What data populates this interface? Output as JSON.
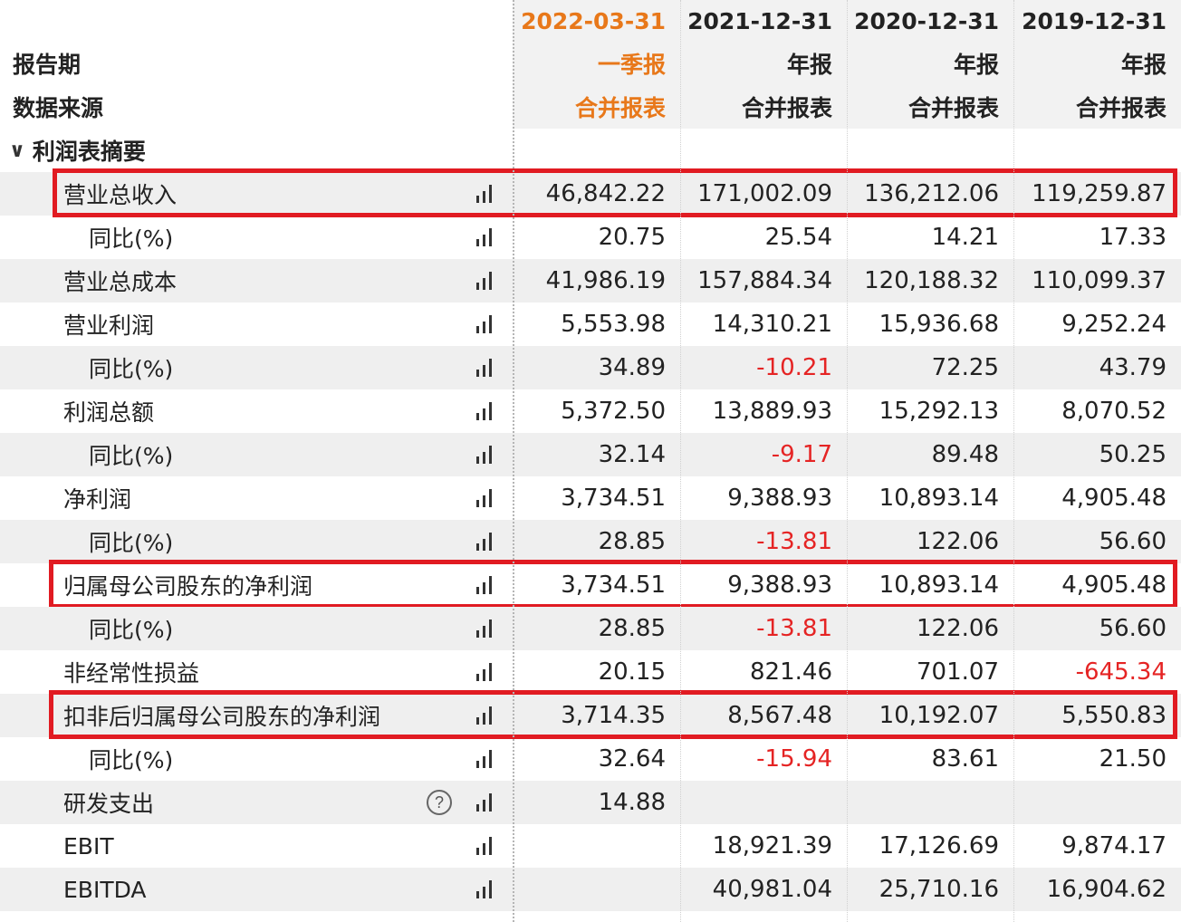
{
  "header": {
    "period_label": "报告期",
    "source_label": "数据来源",
    "columns": [
      {
        "date": "2022-03-31",
        "period": "一季报",
        "source": "合并报表",
        "highlight": true
      },
      {
        "date": "2021-12-31",
        "period": "年报",
        "source": "合并报表",
        "highlight": false
      },
      {
        "date": "2020-12-31",
        "period": "年报",
        "source": "合并报表",
        "highlight": false
      },
      {
        "date": "2019-12-31",
        "period": "年报",
        "source": "合并报表",
        "highlight": false
      }
    ]
  },
  "section": {
    "title": "利润表摘要",
    "icon": "chevron-down-icon"
  },
  "rows": [
    {
      "label": "营业总收入",
      "indent": 1,
      "values": [
        "46,842.22",
        "171,002.09",
        "136,212.06",
        "119,259.87"
      ],
      "negative": [
        false,
        false,
        false,
        false
      ],
      "highlighted": true
    },
    {
      "label": "同比(%)",
      "indent": 2,
      "values": [
        "20.75",
        "25.54",
        "14.21",
        "17.33"
      ],
      "negative": [
        false,
        false,
        false,
        false
      ]
    },
    {
      "label": "营业总成本",
      "indent": 1,
      "values": [
        "41,986.19",
        "157,884.34",
        "120,188.32",
        "110,099.37"
      ],
      "negative": [
        false,
        false,
        false,
        false
      ]
    },
    {
      "label": "营业利润",
      "indent": 1,
      "values": [
        "5,553.98",
        "14,310.21",
        "15,936.68",
        "9,252.24"
      ],
      "negative": [
        false,
        false,
        false,
        false
      ]
    },
    {
      "label": "同比(%)",
      "indent": 2,
      "values": [
        "34.89",
        "-10.21",
        "72.25",
        "43.79"
      ],
      "negative": [
        false,
        true,
        false,
        false
      ]
    },
    {
      "label": "利润总额",
      "indent": 1,
      "values": [
        "5,372.50",
        "13,889.93",
        "15,292.13",
        "8,070.52"
      ],
      "negative": [
        false,
        false,
        false,
        false
      ]
    },
    {
      "label": "同比(%)",
      "indent": 2,
      "values": [
        "32.14",
        "-9.17",
        "89.48",
        "50.25"
      ],
      "negative": [
        false,
        true,
        false,
        false
      ]
    },
    {
      "label": "净利润",
      "indent": 1,
      "values": [
        "3,734.51",
        "9,388.93",
        "10,893.14",
        "4,905.48"
      ],
      "negative": [
        false,
        false,
        false,
        false
      ]
    },
    {
      "label": "同比(%)",
      "indent": 2,
      "values": [
        "28.85",
        "-13.81",
        "122.06",
        "56.60"
      ],
      "negative": [
        false,
        true,
        false,
        false
      ]
    },
    {
      "label": "归属母公司股东的净利润",
      "indent": 1,
      "values": [
        "3,734.51",
        "9,388.93",
        "10,893.14",
        "4,905.48"
      ],
      "negative": [
        false,
        false,
        false,
        false
      ],
      "highlighted": true
    },
    {
      "label": "同比(%)",
      "indent": 2,
      "values": [
        "28.85",
        "-13.81",
        "122.06",
        "56.60"
      ],
      "negative": [
        false,
        true,
        false,
        false
      ]
    },
    {
      "label": "非经常性损益",
      "indent": 1,
      "values": [
        "20.15",
        "821.46",
        "701.07",
        "-645.34"
      ],
      "negative": [
        false,
        false,
        false,
        true
      ]
    },
    {
      "label": "扣非后归属母公司股东的净利润",
      "indent": 1,
      "values": [
        "3,714.35",
        "8,567.48",
        "10,192.07",
        "5,550.83"
      ],
      "negative": [
        false,
        false,
        false,
        false
      ],
      "highlighted": true
    },
    {
      "label": "同比(%)",
      "indent": 2,
      "values": [
        "32.64",
        "-15.94",
        "83.61",
        "21.50"
      ],
      "negative": [
        false,
        true,
        false,
        false
      ]
    },
    {
      "label": "研发支出",
      "indent": 1,
      "values": [
        "14.88",
        "",
        "",
        ""
      ],
      "negative": [
        false,
        false,
        false,
        false
      ],
      "help_icon": "question-circle-icon"
    },
    {
      "label": "EBIT",
      "indent": 1,
      "values": [
        "",
        "18,921.39",
        "17,126.69",
        "9,874.17"
      ],
      "negative": [
        false,
        false,
        false,
        false
      ]
    },
    {
      "label": "EBITDA",
      "indent": 1,
      "values": [
        "",
        "40,981.04",
        "25,710.16",
        "16,904.62"
      ],
      "negative": [
        false,
        false,
        false,
        false
      ]
    }
  ],
  "help_icon_glyph": "?",
  "row_icon": "bar-chart-icon",
  "colors": {
    "accent": "#e8781a",
    "negative": "#e52424",
    "highlight_box": "#e11b22",
    "row_shade": "#efefef",
    "header_bg": "#f2f2f2"
  }
}
